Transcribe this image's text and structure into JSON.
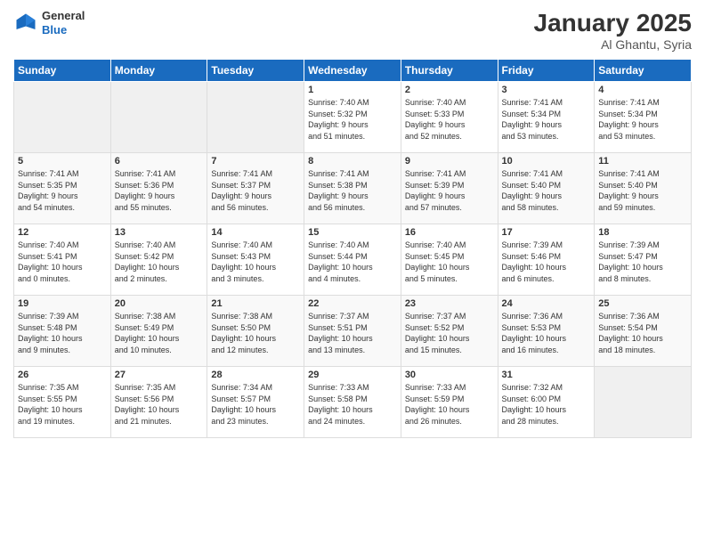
{
  "header": {
    "logo_general": "General",
    "logo_blue": "Blue",
    "title": "January 2025",
    "subtitle": "Al Ghantu, Syria"
  },
  "days_of_week": [
    "Sunday",
    "Monday",
    "Tuesday",
    "Wednesday",
    "Thursday",
    "Friday",
    "Saturday"
  ],
  "weeks": [
    [
      {
        "num": "",
        "info": ""
      },
      {
        "num": "",
        "info": ""
      },
      {
        "num": "",
        "info": ""
      },
      {
        "num": "1",
        "info": "Sunrise: 7:40 AM\nSunset: 5:32 PM\nDaylight: 9 hours\nand 51 minutes."
      },
      {
        "num": "2",
        "info": "Sunrise: 7:40 AM\nSunset: 5:33 PM\nDaylight: 9 hours\nand 52 minutes."
      },
      {
        "num": "3",
        "info": "Sunrise: 7:41 AM\nSunset: 5:34 PM\nDaylight: 9 hours\nand 53 minutes."
      },
      {
        "num": "4",
        "info": "Sunrise: 7:41 AM\nSunset: 5:34 PM\nDaylight: 9 hours\nand 53 minutes."
      }
    ],
    [
      {
        "num": "5",
        "info": "Sunrise: 7:41 AM\nSunset: 5:35 PM\nDaylight: 9 hours\nand 54 minutes."
      },
      {
        "num": "6",
        "info": "Sunrise: 7:41 AM\nSunset: 5:36 PM\nDaylight: 9 hours\nand 55 minutes."
      },
      {
        "num": "7",
        "info": "Sunrise: 7:41 AM\nSunset: 5:37 PM\nDaylight: 9 hours\nand 56 minutes."
      },
      {
        "num": "8",
        "info": "Sunrise: 7:41 AM\nSunset: 5:38 PM\nDaylight: 9 hours\nand 56 minutes."
      },
      {
        "num": "9",
        "info": "Sunrise: 7:41 AM\nSunset: 5:39 PM\nDaylight: 9 hours\nand 57 minutes."
      },
      {
        "num": "10",
        "info": "Sunrise: 7:41 AM\nSunset: 5:40 PM\nDaylight: 9 hours\nand 58 minutes."
      },
      {
        "num": "11",
        "info": "Sunrise: 7:41 AM\nSunset: 5:40 PM\nDaylight: 9 hours\nand 59 minutes."
      }
    ],
    [
      {
        "num": "12",
        "info": "Sunrise: 7:40 AM\nSunset: 5:41 PM\nDaylight: 10 hours\nand 0 minutes."
      },
      {
        "num": "13",
        "info": "Sunrise: 7:40 AM\nSunset: 5:42 PM\nDaylight: 10 hours\nand 2 minutes."
      },
      {
        "num": "14",
        "info": "Sunrise: 7:40 AM\nSunset: 5:43 PM\nDaylight: 10 hours\nand 3 minutes."
      },
      {
        "num": "15",
        "info": "Sunrise: 7:40 AM\nSunset: 5:44 PM\nDaylight: 10 hours\nand 4 minutes."
      },
      {
        "num": "16",
        "info": "Sunrise: 7:40 AM\nSunset: 5:45 PM\nDaylight: 10 hours\nand 5 minutes."
      },
      {
        "num": "17",
        "info": "Sunrise: 7:39 AM\nSunset: 5:46 PM\nDaylight: 10 hours\nand 6 minutes."
      },
      {
        "num": "18",
        "info": "Sunrise: 7:39 AM\nSunset: 5:47 PM\nDaylight: 10 hours\nand 8 minutes."
      }
    ],
    [
      {
        "num": "19",
        "info": "Sunrise: 7:39 AM\nSunset: 5:48 PM\nDaylight: 10 hours\nand 9 minutes."
      },
      {
        "num": "20",
        "info": "Sunrise: 7:38 AM\nSunset: 5:49 PM\nDaylight: 10 hours\nand 10 minutes."
      },
      {
        "num": "21",
        "info": "Sunrise: 7:38 AM\nSunset: 5:50 PM\nDaylight: 10 hours\nand 12 minutes."
      },
      {
        "num": "22",
        "info": "Sunrise: 7:37 AM\nSunset: 5:51 PM\nDaylight: 10 hours\nand 13 minutes."
      },
      {
        "num": "23",
        "info": "Sunrise: 7:37 AM\nSunset: 5:52 PM\nDaylight: 10 hours\nand 15 minutes."
      },
      {
        "num": "24",
        "info": "Sunrise: 7:36 AM\nSunset: 5:53 PM\nDaylight: 10 hours\nand 16 minutes."
      },
      {
        "num": "25",
        "info": "Sunrise: 7:36 AM\nSunset: 5:54 PM\nDaylight: 10 hours\nand 18 minutes."
      }
    ],
    [
      {
        "num": "26",
        "info": "Sunrise: 7:35 AM\nSunset: 5:55 PM\nDaylight: 10 hours\nand 19 minutes."
      },
      {
        "num": "27",
        "info": "Sunrise: 7:35 AM\nSunset: 5:56 PM\nDaylight: 10 hours\nand 21 minutes."
      },
      {
        "num": "28",
        "info": "Sunrise: 7:34 AM\nSunset: 5:57 PM\nDaylight: 10 hours\nand 23 minutes."
      },
      {
        "num": "29",
        "info": "Sunrise: 7:33 AM\nSunset: 5:58 PM\nDaylight: 10 hours\nand 24 minutes."
      },
      {
        "num": "30",
        "info": "Sunrise: 7:33 AM\nSunset: 5:59 PM\nDaylight: 10 hours\nand 26 minutes."
      },
      {
        "num": "31",
        "info": "Sunrise: 7:32 AM\nSunset: 6:00 PM\nDaylight: 10 hours\nand 28 minutes."
      },
      {
        "num": "",
        "info": ""
      }
    ]
  ]
}
